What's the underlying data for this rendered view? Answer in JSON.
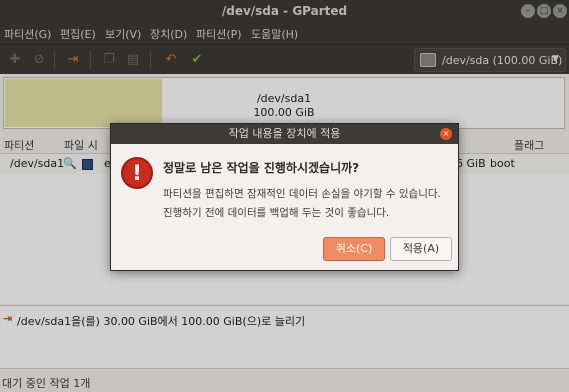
{
  "window": {
    "title": "/dev/sda - GParted",
    "controls": {
      "minimize": "–",
      "maximize": "□",
      "close": "×"
    }
  },
  "menu": [
    "파티션(G)",
    "편집(E)",
    "보기(V)",
    "장치(D)",
    "파티션(P)",
    "도움말(H)"
  ],
  "toolbar": {
    "icons": [
      "new-partition-icon",
      "delete-icon",
      "resize-move-icon",
      "copy-icon",
      "paste-icon",
      "undo-icon",
      "apply-icon"
    ],
    "device_selector": "/dev/sda  (100.00 GiB)"
  },
  "disk_map": {
    "partition_name": "/dev/sda1",
    "partition_size": "100.00 GiB"
  },
  "table": {
    "headers": [
      "파티션",
      "파일 시",
      "플래그"
    ],
    "rows": [
      {
        "partition": "/dev/sda1",
        "fs": "e",
        "size_tail": "6 GiB",
        "flags": "boot"
      }
    ]
  },
  "pending": {
    "operation": "/dev/sda1을(를) 30.00 GiB에서 100.00 GiB(으)로 늘리기"
  },
  "status": {
    "text": "대기 중인 작업 1개"
  },
  "dialog": {
    "title": "작업 내용을 장치에 적용",
    "heading": "정말로 남은 작업을 진행하시겠습니까?",
    "body_line1": "파티션을 편집하면 잠재적인 데이터 손실을 야기할 수 있습니다.",
    "body_line2": "진행하기 전에 데이터를 백업해 두는 것이 좋습니다.",
    "cancel_label": "취소(C)",
    "apply_label": "적용(A)",
    "close_glyph": "×",
    "warning_glyph": "!"
  },
  "colors": {
    "titlebar": "#3c3b37",
    "accent": "#e95420",
    "partition_fill": "#e7e4a6",
    "cancel_button": "#f08c63"
  }
}
